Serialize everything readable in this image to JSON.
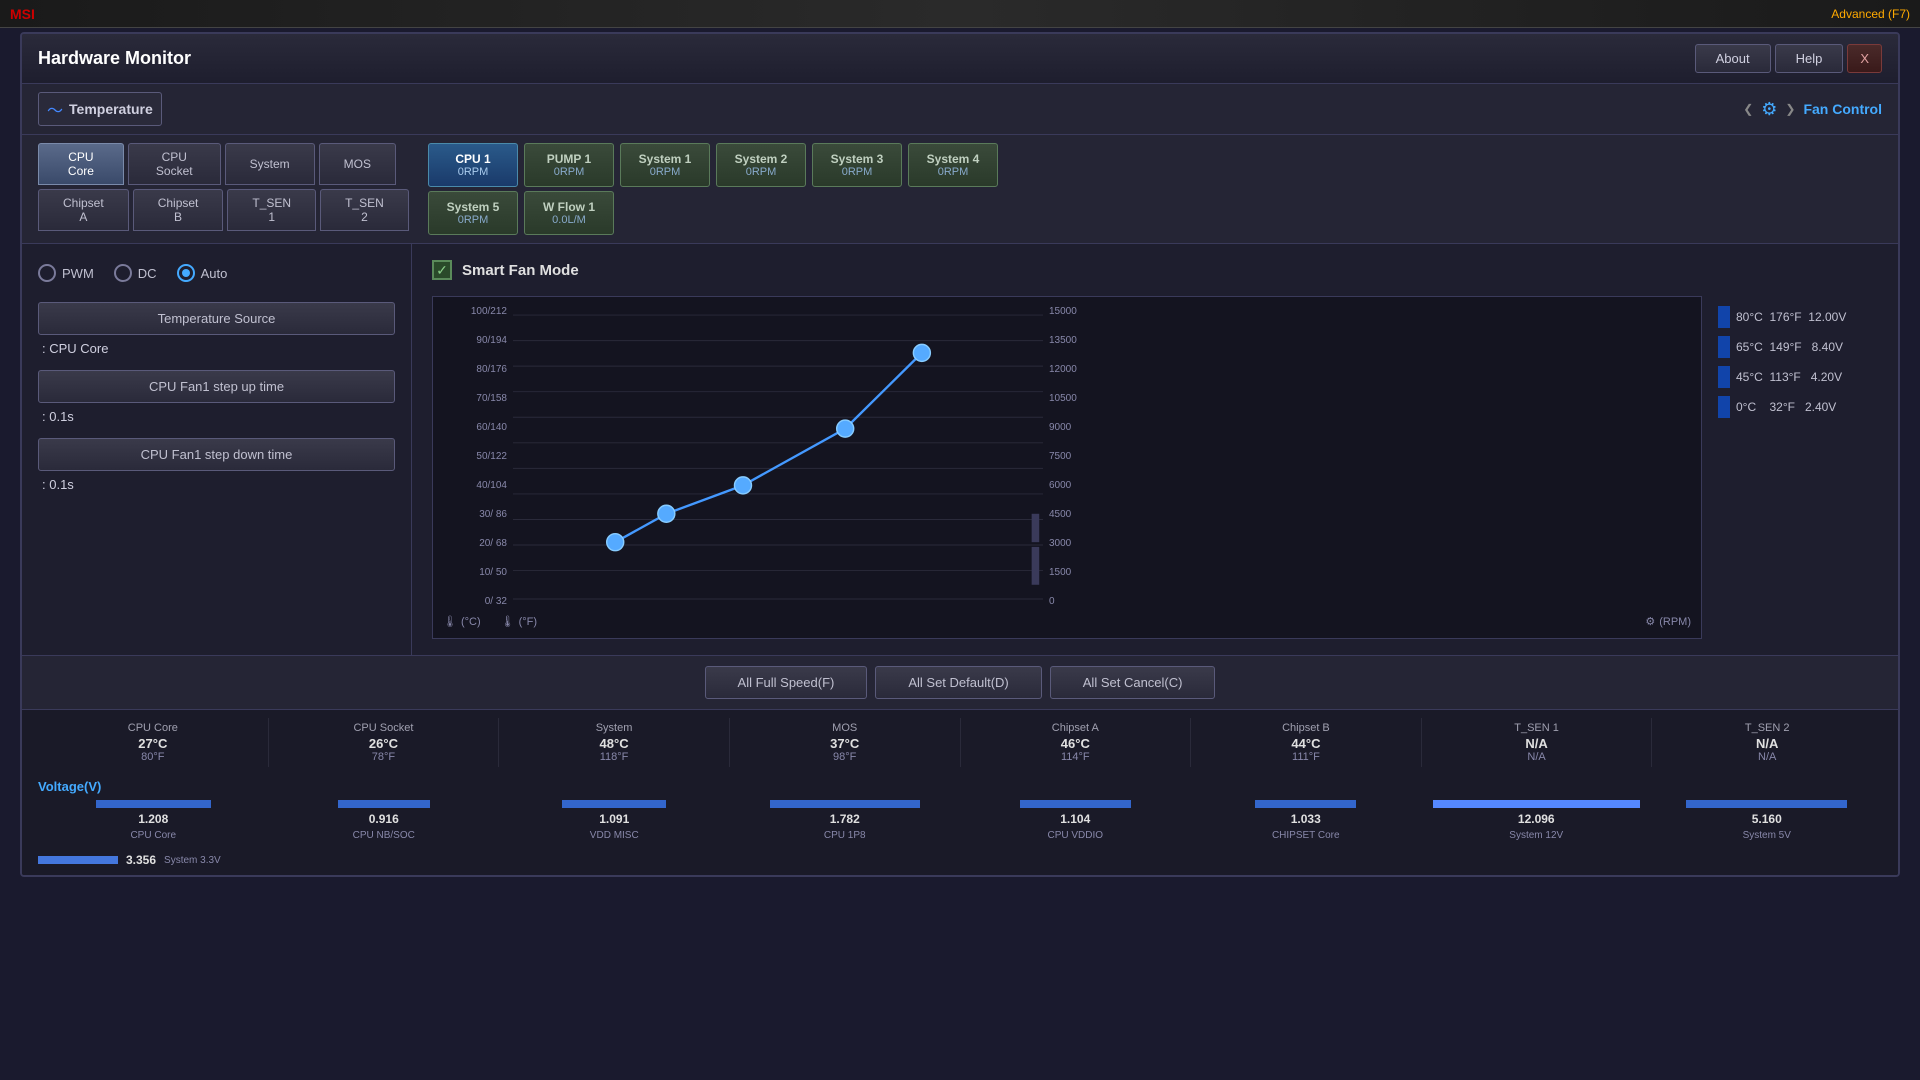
{
  "window": {
    "title": "Hardware Monitor",
    "about_label": "About",
    "help_label": "Help",
    "close_label": "X"
  },
  "nav": {
    "temp_label": "Temperature",
    "fan_control_label": "Fan Control",
    "arrow_left": "❮",
    "arrow_right": "❯"
  },
  "temp_tabs": [
    {
      "id": "cpu-core",
      "label": "CPU Core",
      "active": true
    },
    {
      "id": "cpu-socket",
      "label": "CPU Socket",
      "active": false
    },
    {
      "id": "system",
      "label": "System",
      "active": false
    },
    {
      "id": "mos",
      "label": "MOS",
      "active": false
    },
    {
      "id": "chipset-a",
      "label": "Chipset A",
      "active": false
    },
    {
      "id": "chipset-b",
      "label": "Chipset B",
      "active": false
    },
    {
      "id": "t-sen1",
      "label": "T_SEN 1",
      "active": false
    },
    {
      "id": "t-sen2",
      "label": "T_SEN 2",
      "active": false
    }
  ],
  "fan_buttons": [
    {
      "id": "cpu1",
      "label": "CPU 1",
      "rpm": "0RPM",
      "active": true
    },
    {
      "id": "pump1",
      "label": "PUMP 1",
      "rpm": "0RPM",
      "active": false
    },
    {
      "id": "system1",
      "label": "System 1",
      "rpm": "0RPM",
      "active": false
    },
    {
      "id": "system2",
      "label": "System 2",
      "rpm": "0RPM",
      "active": false
    },
    {
      "id": "system3",
      "label": "System 3",
      "rpm": "0RPM",
      "active": false
    },
    {
      "id": "system4",
      "label": "System 4",
      "rpm": "0RPM",
      "active": false
    },
    {
      "id": "system5",
      "label": "System 5",
      "rpm": "0RPM",
      "active": false
    },
    {
      "id": "wflow1",
      "label": "W Flow 1",
      "rpm": "0.0L/M",
      "active": false
    }
  ],
  "left_panel": {
    "modes": [
      {
        "id": "pwm",
        "label": "PWM",
        "selected": false
      },
      {
        "id": "dc",
        "label": "DC",
        "selected": false
      },
      {
        "id": "auto",
        "label": "Auto",
        "selected": true
      }
    ],
    "temp_source_label": "Temperature Source",
    "temp_source_value": ": CPU Core",
    "step_up_label": "CPU Fan1 step up time",
    "step_up_value": ": 0.1s",
    "step_down_label": "CPU Fan1 step down time",
    "step_down_value": ": 0.1s"
  },
  "chart": {
    "smart_fan_label": "Smart Fan Mode",
    "y_labels_left": [
      "100/212",
      "90/194",
      "80/176",
      "70/158",
      "60/140",
      "50/122",
      "40/104",
      "30/ 86",
      "20/ 68",
      "10/ 50",
      "0/ 32"
    ],
    "y_labels_right": [
      "15000",
      "13500",
      "12000",
      "10500",
      "9000",
      "7500",
      "6000",
      "4500",
      "3000",
      "1500",
      "0"
    ],
    "celsius_label": "(°C)",
    "fahrenheit_label": "(°F)",
    "rpm_label": "(RPM)",
    "voltage_levels": [
      {
        "celsius": "80°C",
        "fahrenheit": "176°F",
        "volts": "12.00V"
      },
      {
        "celsius": "65°C",
        "fahrenheit": "149°F",
        "volts": "8.40V"
      },
      {
        "celsius": "45°C",
        "fahrenheit": "113°F",
        "volts": "4.20V"
      },
      {
        "celsius": "0°C",
        "fahrenheit": "32°F",
        "volts": "2.40V"
      }
    ]
  },
  "bottom_buttons": [
    {
      "id": "all-full-speed",
      "label": "All Full Speed(F)"
    },
    {
      "id": "all-set-default",
      "label": "All Set Default(D)"
    },
    {
      "id": "all-set-cancel",
      "label": "All Set Cancel(C)"
    }
  ],
  "sensors": [
    {
      "name": "CPU Core",
      "celsius": "27°C",
      "fahrenheit": "80°F"
    },
    {
      "name": "CPU Socket",
      "celsius": "26°C",
      "fahrenheit": "78°F"
    },
    {
      "name": "System",
      "celsius": "48°C",
      "fahrenheit": "118°F"
    },
    {
      "name": "MOS",
      "celsius": "37°C",
      "fahrenheit": "98°F"
    },
    {
      "name": "Chipset A",
      "celsius": "46°C",
      "fahrenheit": "114°F"
    },
    {
      "name": "Chipset B",
      "celsius": "44°C",
      "fahrenheit": "111°F"
    },
    {
      "name": "T_SEN 1",
      "celsius": "N/A",
      "fahrenheit": "N/A"
    },
    {
      "name": "T_SEN 2",
      "celsius": "N/A",
      "fahrenheit": "N/A"
    }
  ],
  "voltage_label": "Voltage(V)",
  "voltage_sensors": [
    {
      "name": "CPU Core",
      "value": "1.208",
      "highlight": false
    },
    {
      "name": "CPU NB/SOC",
      "value": "0.916",
      "highlight": false
    },
    {
      "name": "VDD MISC",
      "value": "1.091",
      "highlight": false
    },
    {
      "name": "CPU 1P8",
      "value": "1.782",
      "highlight": false
    },
    {
      "name": "CPU VDDIO",
      "value": "1.104",
      "highlight": false
    },
    {
      "name": "CHIPSET Core",
      "value": "1.033",
      "highlight": false
    },
    {
      "name": "System 12V",
      "value": "12.096",
      "highlight": true
    },
    {
      "name": "System 5V",
      "value": "5.160",
      "highlight": false
    }
  ],
  "system33v": {
    "value": "3.356",
    "name": "System 3.3V"
  }
}
